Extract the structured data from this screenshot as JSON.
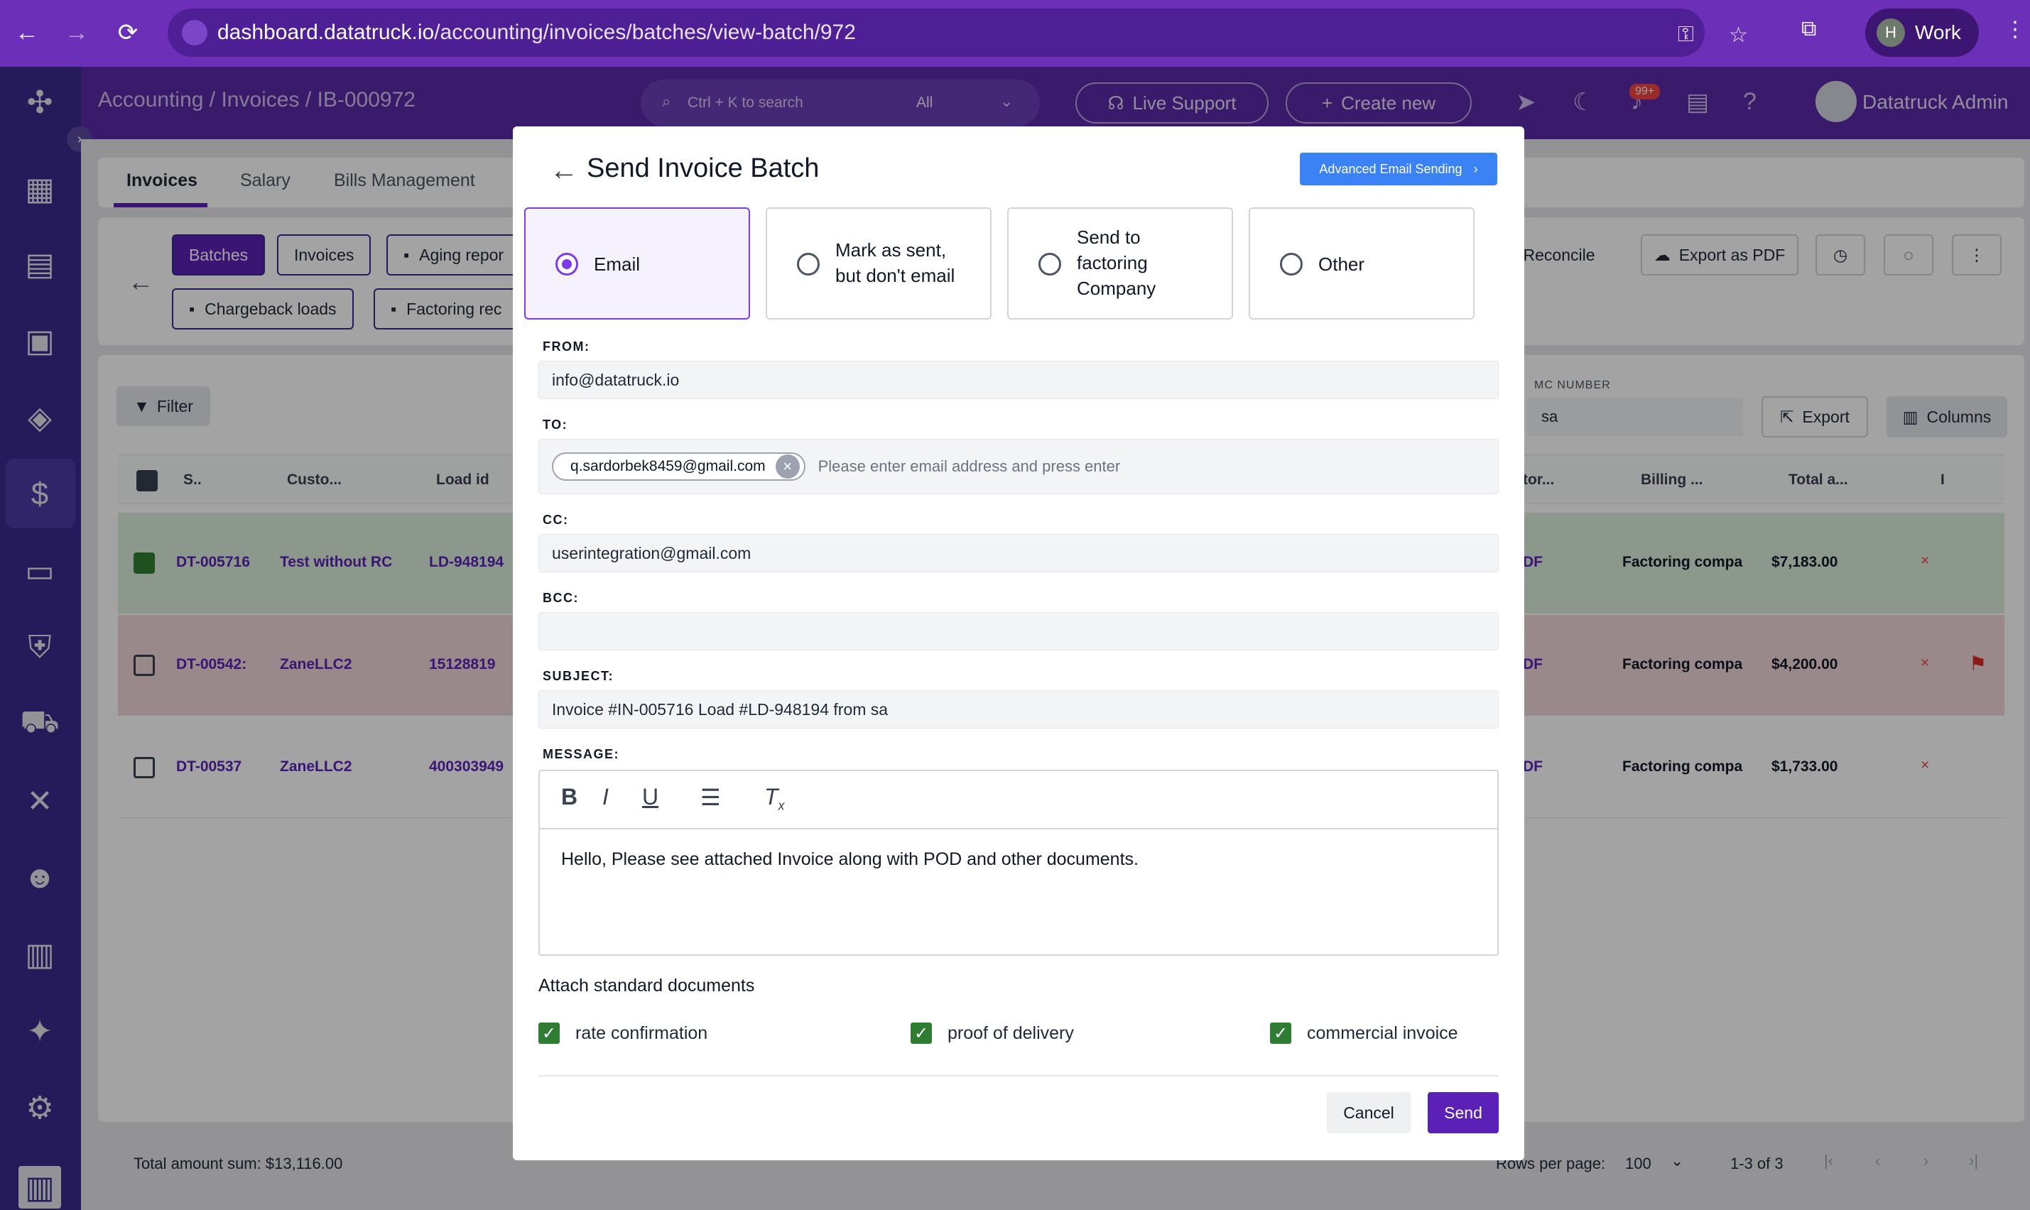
{
  "browser": {
    "url_host": "dashboard.datatruck.io",
    "url_path": "/accounting/invoices/batches/view-batch/972",
    "profile_initial": "H",
    "profile_name": "Work"
  },
  "header": {
    "breadcrumb": "Accounting  /  Invoices  /  IB-000972",
    "search_placeholder": "Ctrl + K to search",
    "search_scope": "All",
    "live_support": "Live Support",
    "create_new": "Create new",
    "notification_badge": "99+",
    "user_name": "Datatruck Admin"
  },
  "tabs": [
    "Invoices",
    "Salary",
    "Bills Management"
  ],
  "toolbar": {
    "batches": "Batches",
    "invoices": "Invoices",
    "aging": "Aging repor",
    "chargeback": "Chargeback loads",
    "factoring": "Factoring rec",
    "reconcile": "Reconcile",
    "export_pdf": "Export as PDF",
    "filter": "Filter",
    "export": "Export",
    "columns": "Columns",
    "mc_label": "MC NUMBER",
    "mc_value": "sa"
  },
  "table": {
    "headers": [
      "S..",
      "Custo...",
      "Load id",
      "tor...",
      "Billing ...",
      "Total a...",
      "I"
    ],
    "rows": [
      {
        "id": "DT-005716",
        "customer": "Test without RC",
        "load": "LD-948194",
        "partial": "DF",
        "billing": "Factoring compa",
        "total": "$7,183.00"
      },
      {
        "id": "DT-00542:",
        "customer": "ZaneLLC2",
        "load": "15128819",
        "partial": "DF",
        "billing": "Factoring compa",
        "total": "$4,200.00"
      },
      {
        "id": "DT-00537",
        "customer": "ZaneLLC2",
        "load": "400303949",
        "partial": "DF",
        "billing": "Factoring compa",
        "total": "$1,733.00"
      }
    ],
    "total_sum": "Total amount sum: $13,116.00",
    "rows_per_page_label": "Rows per page:",
    "rows_per_page": "100",
    "range": "1-3 of 3"
  },
  "modal": {
    "title": "Send Invoice Batch",
    "advanced_btn": "Advanced Email Sending",
    "options": {
      "email": "Email",
      "mark_sent_1": "Mark as sent,",
      "mark_sent_2": "but don't email",
      "factoring_1": "Send to",
      "factoring_2": "factoring",
      "factoring_3": "Company",
      "other": "Other"
    },
    "from_label": "FROM:",
    "from_value": "info@datatruck.io",
    "to_label": "TO:",
    "to_chip": "q.sardorbek8459@gmail.com",
    "to_placeholder": "Please enter email address and press enter",
    "cc_label": "CC:",
    "cc_value": "userintegration@gmail.com",
    "bcc_label": "BCC:",
    "bcc_value": "",
    "subject_label": "SUBJECT:",
    "subject_value": "Invoice #IN-005716 Load #LD-948194 from sa",
    "message_label": "MESSAGE:",
    "message_value": "Hello, Please see attached Invoice along with POD and other documents.",
    "attach_title": "Attach standard documents",
    "attach": [
      "rate confirmation",
      "proof of delivery",
      "commercial invoice"
    ],
    "cancel": "Cancel",
    "send": "Send"
  }
}
